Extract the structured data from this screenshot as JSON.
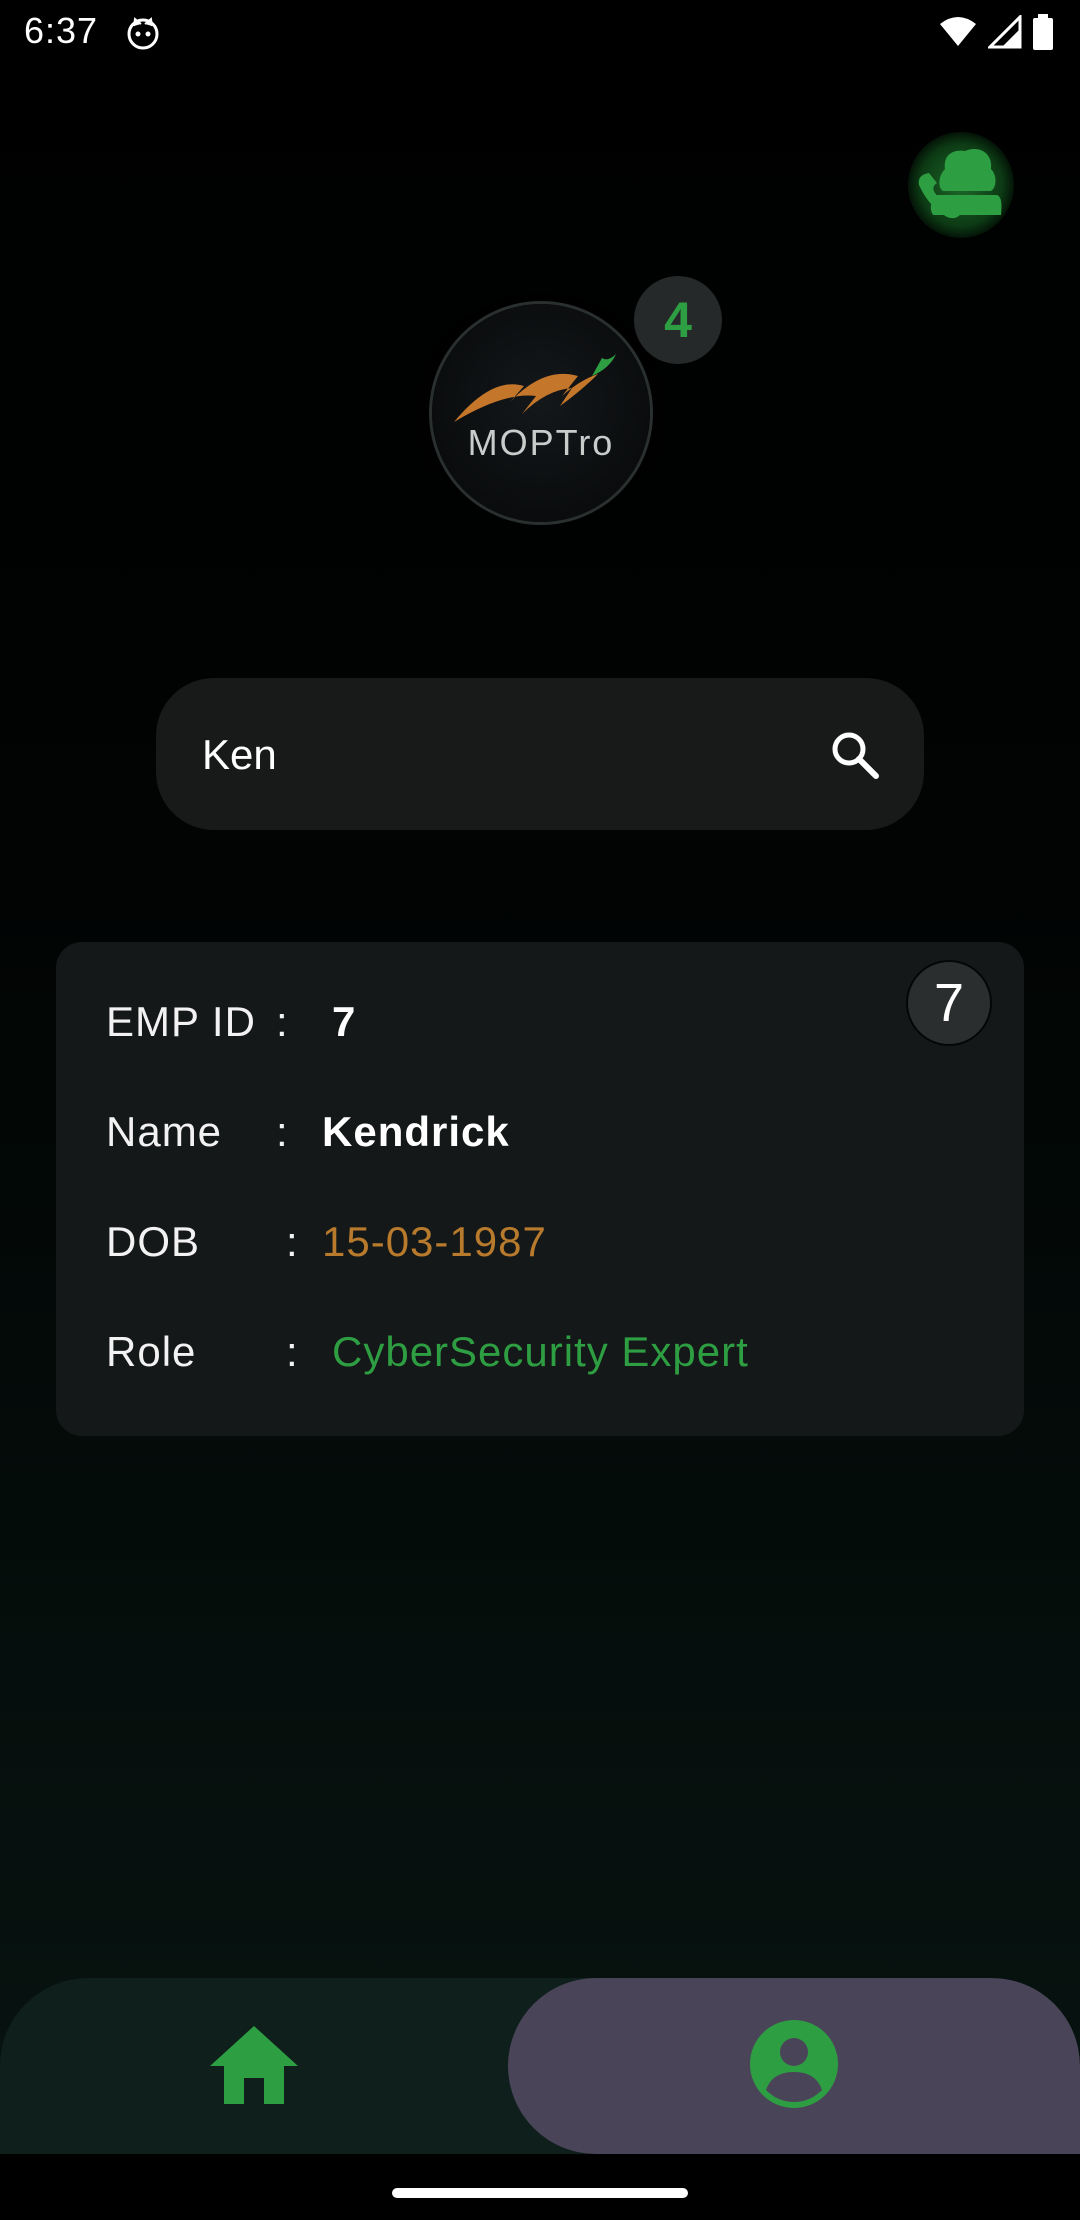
{
  "status_bar": {
    "time": "6:37"
  },
  "header": {
    "count_badge": "4",
    "logo_text": "MOPTro"
  },
  "search": {
    "value": "Ken",
    "placeholder": ""
  },
  "card": {
    "badge": "7",
    "rows": [
      {
        "label": "EMP ID",
        "colon": ":",
        "value": "7"
      },
      {
        "label": "Name",
        "colon": ":",
        "value": "Kendrick"
      },
      {
        "label": "DOB",
        "colon": ":",
        "value": "15-03-1987"
      },
      {
        "label": "Role",
        "colon": ":",
        "value": "CyberSecurity Expert"
      }
    ]
  },
  "colors": {
    "accent_green": "#2e9e43",
    "dob_orange": "#b87a2c",
    "nav_selected": "#4a4458"
  },
  "nav": {
    "items": [
      "home-icon",
      "account-circle-icon"
    ],
    "selected": 1
  }
}
